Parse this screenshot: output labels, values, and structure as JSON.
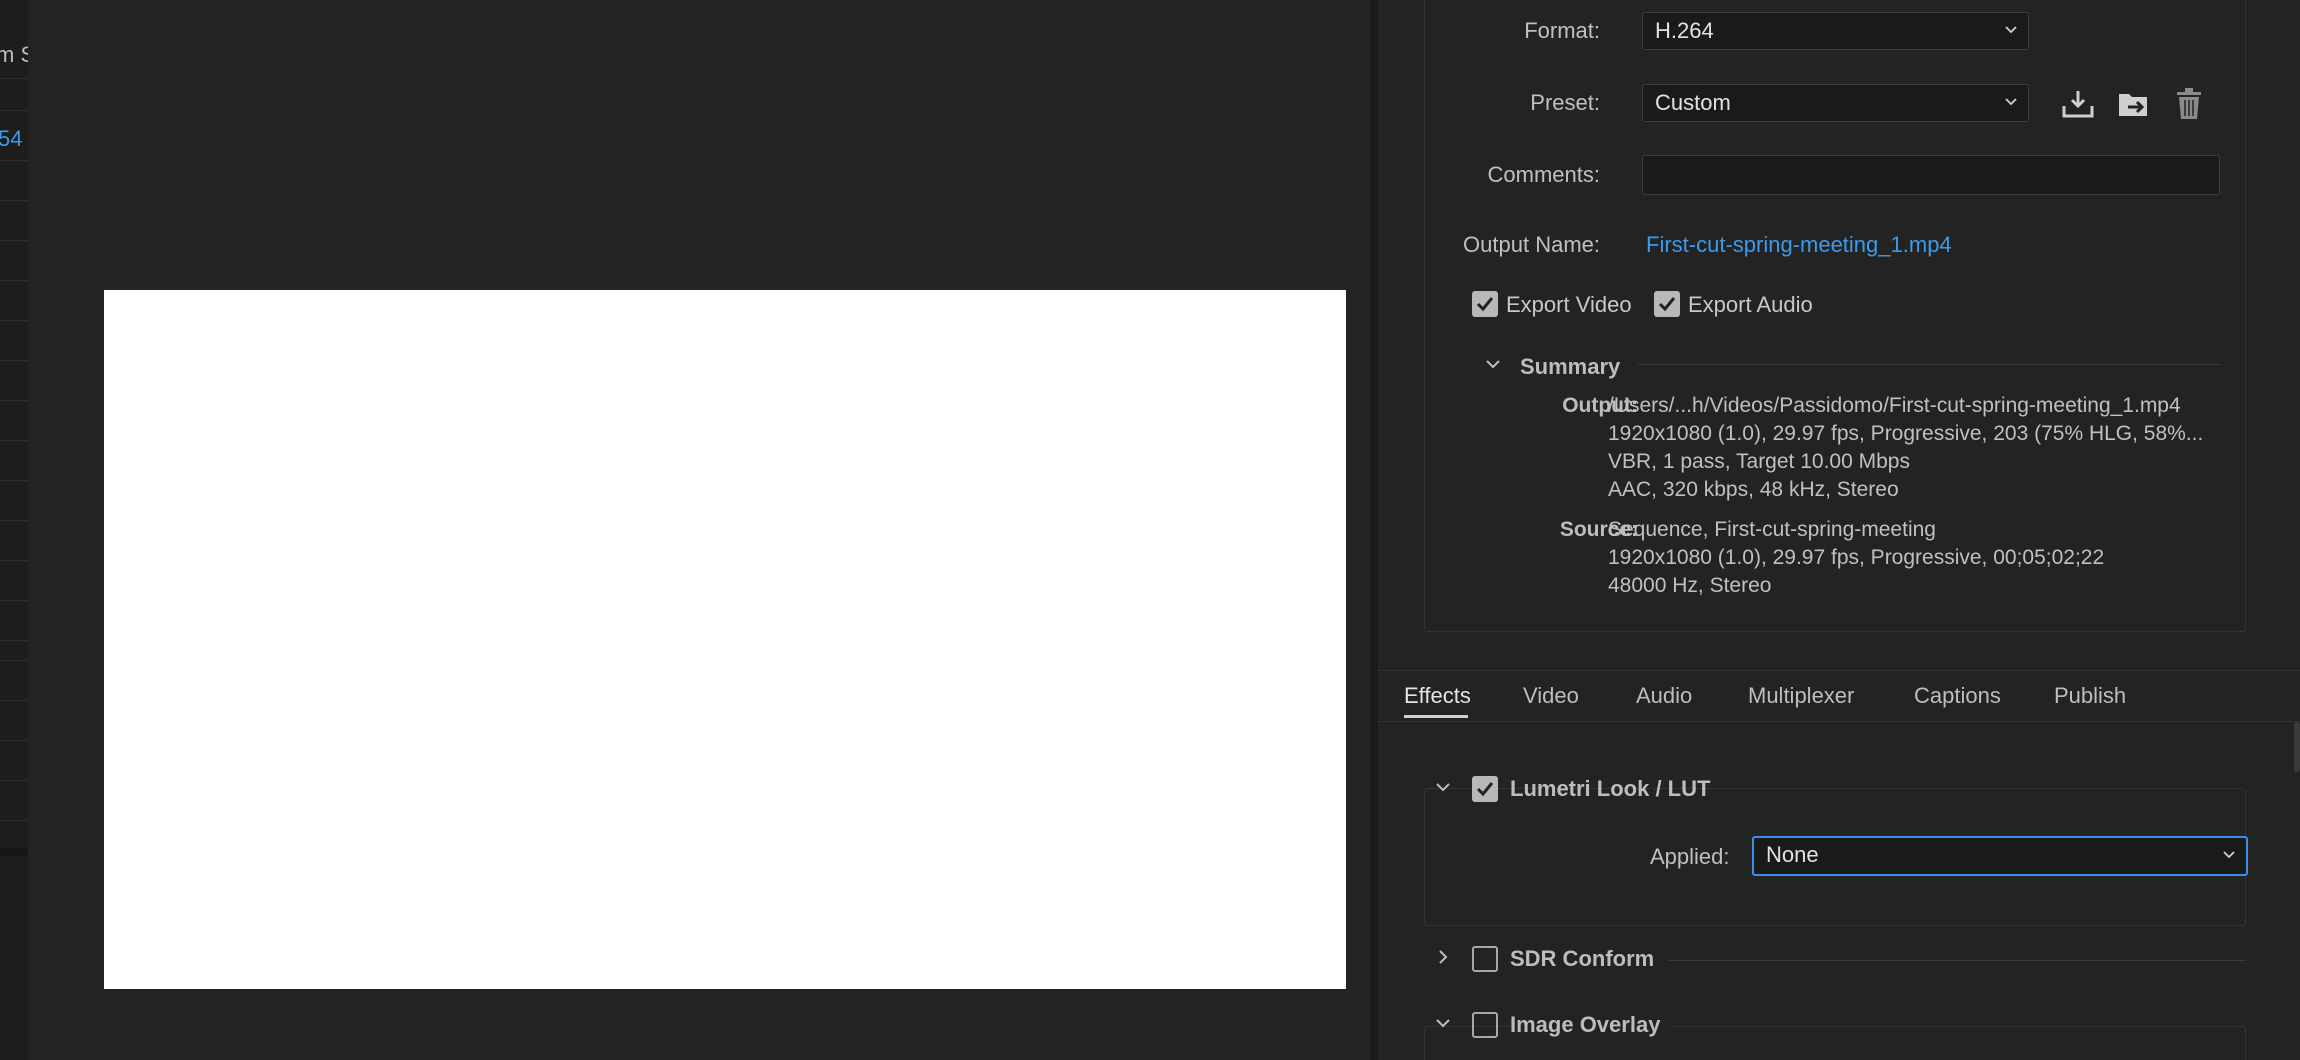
{
  "left_strip": {
    "clipped_text": "m S",
    "clipped_link": "54"
  },
  "export_settings": {
    "format_label": "Format:",
    "format_value": "H.264",
    "preset_label": "Preset:",
    "preset_value": "Custom",
    "comments_label": "Comments:",
    "comments_value": "",
    "output_name_label": "Output Name:",
    "output_name_value": "First-cut-spring-meeting_1.mp4",
    "export_video_label": "Export Video",
    "export_video_checked": true,
    "export_audio_label": "Export Audio",
    "export_audio_checked": true
  },
  "summary": {
    "title": "Summary",
    "output_key": "Output:",
    "output_lines": [
      "/Users/...h/Videos/Passidomo/First-cut-spring-meeting_1.mp4",
      "1920x1080 (1.0), 29.97 fps, Progressive, 203 (75% HLG, 58%...",
      "VBR, 1 pass, Target 10.00 Mbps",
      "AAC, 320 kbps, 48 kHz, Stereo"
    ],
    "source_key": "Source:",
    "source_lines": [
      "Sequence, First-cut-spring-meeting",
      "1920x1080 (1.0), 29.97 fps, Progressive, 00;05;02;22",
      "48000 Hz, Stereo"
    ]
  },
  "tabs": [
    "Effects",
    "Video",
    "Audio",
    "Multiplexer",
    "Captions",
    "Publish"
  ],
  "active_tab": "Effects",
  "effects": {
    "lumetri": {
      "title": "Lumetri Look / LUT",
      "checked": true,
      "applied_label": "Applied:",
      "applied_value": "None"
    },
    "sdr": {
      "title": "SDR Conform",
      "checked": false
    },
    "overlay": {
      "title": "Image Overlay",
      "checked": false
    }
  },
  "colors": {
    "accent": "#3b9bea",
    "focus": "#3b8fe6",
    "panel": "#232323"
  }
}
